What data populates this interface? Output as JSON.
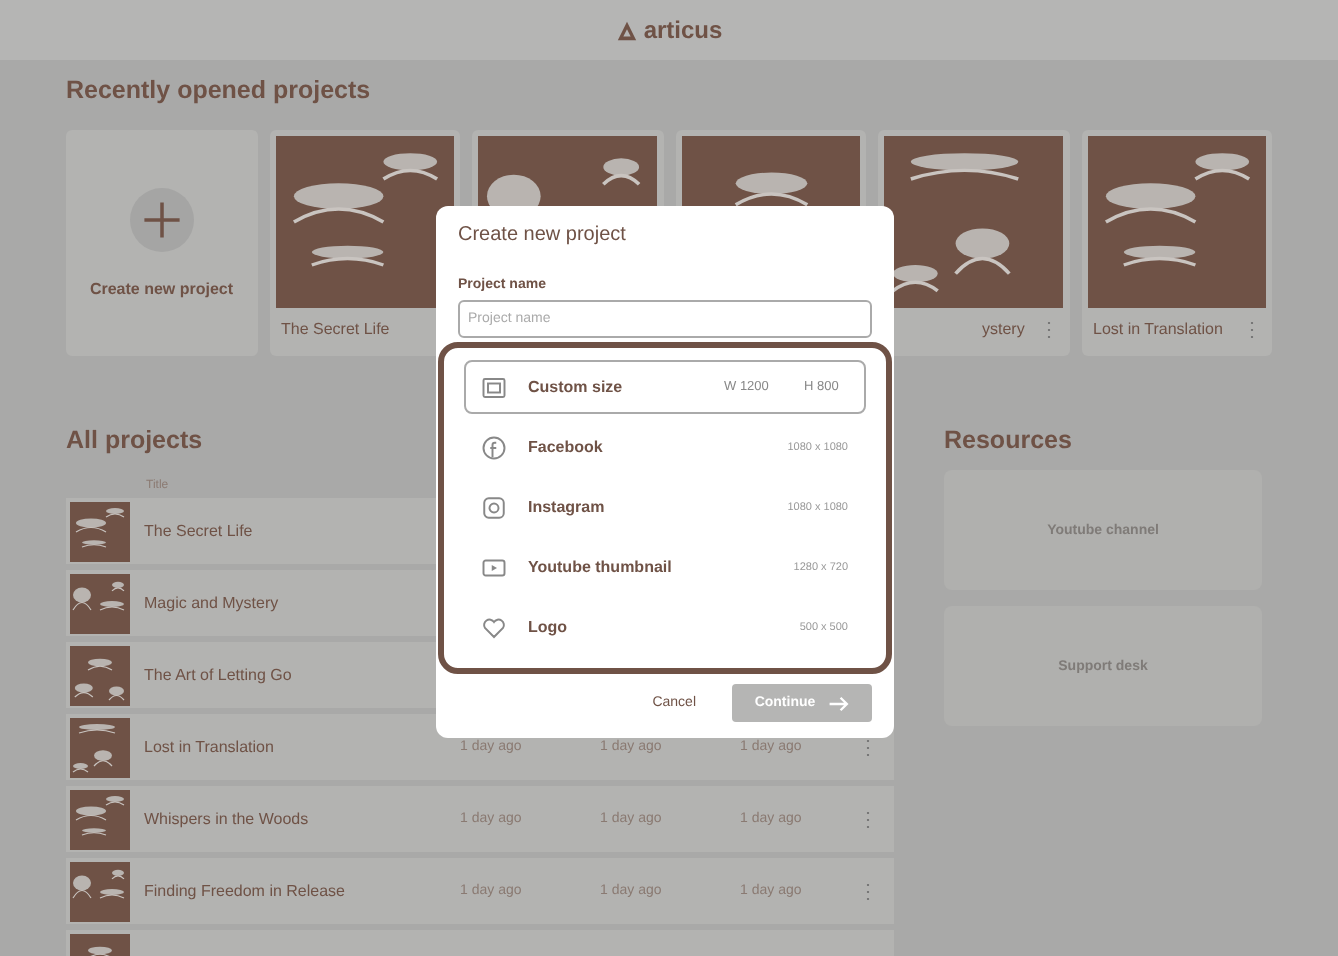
{
  "header": {
    "logo": "articus"
  },
  "recent": {
    "title": "Recently opened projects",
    "create_label": "Create new project",
    "cards": [
      {
        "kind": "picture",
        "label": "The Secret Life"
      },
      {
        "kind": "picture"
      },
      {
        "kind": "picture"
      },
      {
        "kind": "picture",
        "label": "ystery",
        "menu": "⋮"
      },
      {
        "kind": "picture",
        "label": "Lost in Translation",
        "menu": "⋮"
      }
    ]
  },
  "all_projects": {
    "title": "All projects",
    "column_1": "Title",
    "rows": [
      {
        "title": "The Secret Life",
        "dates": []
      },
      {
        "title": "Magic and Mystery",
        "dates": []
      },
      {
        "title": "The Art of Letting Go",
        "dates": []
      },
      {
        "title": "Lost in Translation",
        "dates": [
          "1 day ago",
          "1 day ago",
          "1 day ago"
        ],
        "menu": "⋮"
      },
      {
        "title": "Whispers in the Woods",
        "dates": [
          "1 day ago",
          "1 day ago",
          "1 day ago"
        ],
        "menu": "⋮"
      },
      {
        "title": "Finding Freedom in Release",
        "dates": [
          "1 day ago",
          "1 day ago",
          "1 day ago"
        ],
        "menu": "⋮"
      },
      {
        "dates": []
      }
    ]
  },
  "resources": {
    "title": "Resources",
    "links": [
      "Youtube channel",
      "Support desk"
    ]
  },
  "dialog": {
    "title": "Create new project",
    "field_label": "Project name",
    "placeholder": "Project name",
    "sizes": [
      {
        "kind": "custom",
        "name": "Custom size",
        "width": "W 1200",
        "height": "H 800",
        "selected": true
      },
      {
        "kind": "preset",
        "name": "Facebook",
        "dims": "1080 x 1080",
        "selected": false
      },
      {
        "kind": "preset",
        "name": "Instagram",
        "dims": "1080 x 1080",
        "selected": false
      },
      {
        "kind": "preset",
        "name": "Youtube thumbnail",
        "dims": "1280 x 720",
        "selected": false
      },
      {
        "kind": "preset",
        "name": "Logo",
        "dims": "500 x 500",
        "selected": false
      }
    ],
    "cancel": "Cancel",
    "confirm": {
      "label": "Continue",
      "disabled": true
    }
  }
}
